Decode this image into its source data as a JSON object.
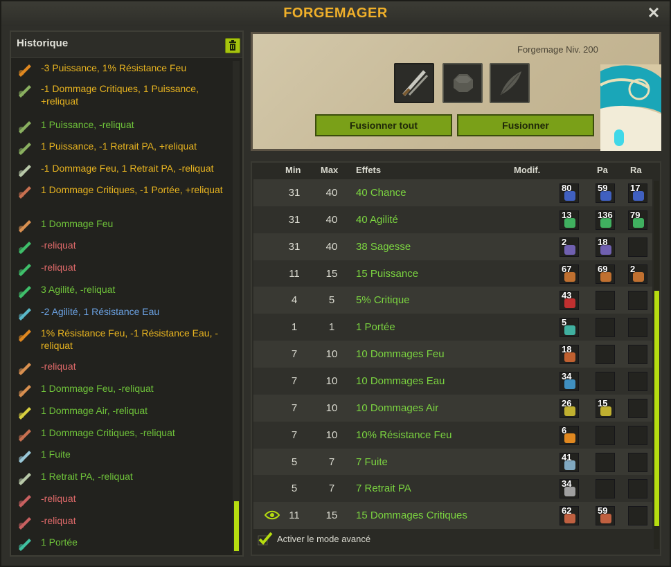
{
  "window": {
    "title": "FORGEMAGER",
    "close_label": "✕"
  },
  "history": {
    "title": "Historique",
    "items": [
      {
        "text": "-3 Puissance, 1% Résistance Feu",
        "color": "#e8b420",
        "icon": "fire-rune-icon",
        "iconColor": "#e08820"
      },
      {
        "text": "-1 Dommage Critiques, 1 Puissance, +reliquat",
        "color": "#e8b420",
        "icon": "weapon-rune-icon",
        "iconColor": "#8ab060"
      },
      {
        "text": "1 Puissance, -reliquat",
        "color": "#6fc33a",
        "icon": "weapon-rune-icon",
        "iconColor": "#8ab060"
      },
      {
        "text": "1 Puissance, -1 Retrait PA, +reliquat",
        "color": "#e8b420",
        "icon": "weapon-rune-icon",
        "iconColor": "#8ab060"
      },
      {
        "text": "-1 Dommage Feu, 1 Retrait PA, -reliquat",
        "color": "#e8b420",
        "icon": "boot-rune-icon",
        "iconColor": "#b8c8a8"
      },
      {
        "text": "1 Dommage Critiques, -1 Portée, +reliquat",
        "color": "#e8b420",
        "icon": "blade-rune-icon",
        "iconColor": "#c87050"
      },
      {
        "text": "1 Dommage Feu",
        "color": "#6fc33a",
        "icon": "blade-rune-icon",
        "iconColor": "#d89050"
      },
      {
        "text": "-reliquat",
        "color": "#e06a6a",
        "icon": "green-gem-icon",
        "iconColor": "#3fbf6a"
      },
      {
        "text": "-reliquat",
        "color": "#e06a6a",
        "icon": "green-gem-icon",
        "iconColor": "#3fbf6a"
      },
      {
        "text": "3 Agilité, -reliquat",
        "color": "#6fc33a",
        "icon": "green-gem-icon",
        "iconColor": "#3fbf6a"
      },
      {
        "text": "-2 Agilité, 1 Résistance Eau",
        "color": "#6aa0e0",
        "icon": "water-rune-icon",
        "iconColor": "#5ab8c8"
      },
      {
        "text": "1% Résistance Feu, -1 Résistance Eau, -reliquat",
        "color": "#e8b420",
        "icon": "fire-rune-icon",
        "iconColor": "#e08820"
      },
      {
        "text": "-reliquat",
        "color": "#e06a6a",
        "icon": "blade-rune-icon",
        "iconColor": "#d89050"
      },
      {
        "text": "1 Dommage Feu, -reliquat",
        "color": "#6fc33a",
        "icon": "blade-rune-icon",
        "iconColor": "#d89050"
      },
      {
        "text": "1 Dommage Air, -reliquat",
        "color": "#6fc33a",
        "icon": "air-rune-icon",
        "iconColor": "#d8d040"
      },
      {
        "text": "1 Dommage Critiques, -reliquat",
        "color": "#6fc33a",
        "icon": "blade-rune-icon",
        "iconColor": "#c87050"
      },
      {
        "text": "1 Fuite",
        "color": "#6fc33a",
        "icon": "boot-rune-icon",
        "iconColor": "#9ac8d8"
      },
      {
        "text": "1 Retrait PA, -reliquat",
        "color": "#6fc33a",
        "icon": "boot-rune-icon",
        "iconColor": "#b8c8a8"
      },
      {
        "text": "-reliquat",
        "color": "#e06a6a",
        "icon": "ring-rune-icon",
        "iconColor": "#c86060"
      },
      {
        "text": "-reliquat",
        "color": "#e06a6a",
        "icon": "ring-rune-icon",
        "iconColor": "#c86060"
      },
      {
        "text": "1 Portée",
        "color": "#6fc33a",
        "icon": "eye-rune-icon",
        "iconColor": "#40c0a0"
      }
    ]
  },
  "fusion": {
    "forge_level": "Forgemage Niv. 200",
    "fuse_all_label": "Fusionner tout",
    "fuse_label": "Fusionner"
  },
  "table": {
    "headers": {
      "min": "Min",
      "max": "Max",
      "effects": "Effets",
      "modif": "Modif.",
      "pa": "Pa",
      "ra": "Ra"
    },
    "rows": [
      {
        "min": "31",
        "max": "40",
        "effect": "40 Chance",
        "ba": "80",
        "pa": "59",
        "ra": "17",
        "gem": "#4060c0"
      },
      {
        "min": "31",
        "max": "40",
        "effect": "40 Agilité",
        "ba": "13",
        "pa": "136",
        "ra": "79",
        "gem": "#40b060"
      },
      {
        "min": "31",
        "max": "40",
        "effect": "38 Sagesse",
        "ba": "2",
        "pa": "18",
        "ra": "",
        "gem": "#7060b0"
      },
      {
        "min": "11",
        "max": "15",
        "effect": "15 Puissance",
        "ba": "67",
        "pa": "69",
        "ra": "2",
        "gem": "#c07030"
      },
      {
        "min": "4",
        "max": "5",
        "effect": "5% Critique",
        "ba": "43",
        "pa": "",
        "ra": "",
        "gem": "#c03030"
      },
      {
        "min": "1",
        "max": "1",
        "effect": "1 Portée",
        "ba": "5",
        "pa": "",
        "ra": "",
        "gem": "#40b0a0"
      },
      {
        "min": "7",
        "max": "10",
        "effect": "10 Dommages Feu",
        "ba": "18",
        "pa": "",
        "ra": "",
        "gem": "#c06030"
      },
      {
        "min": "7",
        "max": "10",
        "effect": "10 Dommages Eau",
        "ba": "34",
        "pa": "",
        "ra": "",
        "gem": "#4090c0"
      },
      {
        "min": "7",
        "max": "10",
        "effect": "10 Dommages Air",
        "ba": "26",
        "pa": "15",
        "ra": "",
        "gem": "#c0b030"
      },
      {
        "min": "7",
        "max": "10",
        "effect": "10% Résistance Feu",
        "ba": "6",
        "pa": "",
        "ra": "",
        "gem": "#e08820"
      },
      {
        "min": "5",
        "max": "7",
        "effect": "7 Fuite",
        "ba": "41",
        "pa": "",
        "ra": "",
        "gem": "#80a8c0"
      },
      {
        "min": "5",
        "max": "7",
        "effect": "7 Retrait PA",
        "ba": "34",
        "pa": "",
        "ra": "",
        "gem": "#a0a0a0"
      },
      {
        "min": "11",
        "max": "15",
        "effect": "15 Dommages Critiques",
        "ba": "62",
        "pa": "59",
        "ra": "",
        "gem": "#c06040"
      }
    ],
    "advanced_mode_label": "Activer le mode avancé"
  }
}
